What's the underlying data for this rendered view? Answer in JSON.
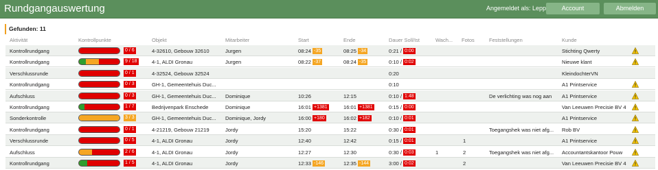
{
  "app": {
    "title": "Rundgangauswertung"
  },
  "header": {
    "logged_in_label": "Angemeldet als: Lepp",
    "account_label": "Account",
    "logout_label": "Abmelden"
  },
  "summary": {
    "found_label": "Gefunden: 11"
  },
  "table": {
    "columns": [
      "Aktivität",
      "Kontrollpunkte",
      "Objekt",
      "Mitarbeiter",
      "Start",
      "Ende",
      "Dauer Soll/Ist",
      "Wach...",
      "Fotos",
      "Feststellungen",
      "Kunde"
    ],
    "rows": [
      {
        "activity": "Kontrollrundgang",
        "progress": "0 / 6",
        "bar": [
          {
            "color": "#e00000",
            "frac": 1
          }
        ],
        "badge_color": "#e00000",
        "object": "4-32610, Gebouw 32610",
        "employee": "Jurgen",
        "start": "08:24",
        "start_badge": "-35",
        "start_badge_color": "#f5a623",
        "end": "08:25",
        "end_badge": "-34",
        "end_badge_color": "#f5a623",
        "duration": "0:21 /",
        "duration_badge": "0:00",
        "duration_badge_color": "#e00000",
        "wach": "",
        "photos": "",
        "findings": "",
        "customer": "Stichting Qwerty",
        "warning": true
      },
      {
        "activity": "Kontrollrundgang",
        "progress": "9 / 18",
        "bar": [
          {
            "color": "#2e9e2e",
            "frac": 0.17
          },
          {
            "color": "#f5a623",
            "frac": 0.33
          },
          {
            "color": "#e00000",
            "frac": 0.5
          }
        ],
        "badge_color": "#e00000",
        "object": "4-1, ALDI Gronau",
        "employee": "Jurgen",
        "start": "08:22",
        "start_badge": "-37",
        "start_badge_color": "#f5a623",
        "end": "08:24",
        "end_badge": "-35",
        "end_badge_color": "#f5a623",
        "duration": "0:10 /",
        "duration_badge": "0:02",
        "duration_badge_color": "#e00000",
        "wach": "",
        "photos": "",
        "findings": "",
        "customer": "Nieuwe klant",
        "warning": true
      },
      {
        "activity": "Verschlussrunde",
        "progress": "0 / 1",
        "bar": [
          {
            "color": "#e00000",
            "frac": 1
          }
        ],
        "badge_color": "#e00000",
        "object": "4-32524, Gebouw 32524",
        "employee": "",
        "start": "",
        "start_badge": "",
        "start_badge_color": "",
        "end": "",
        "end_badge": "",
        "end_badge_color": "",
        "duration": "0:20",
        "duration_badge": "",
        "duration_badge_color": "",
        "wach": "",
        "photos": "",
        "findings": "",
        "customer": "KleindochterVN",
        "warning": false
      },
      {
        "activity": "Kontrollrundgang",
        "progress": "0 / 3",
        "bar": [
          {
            "color": "#e00000",
            "frac": 1
          }
        ],
        "badge_color": "#e00000",
        "object": "GH-1, Gemeentehuis Duc...",
        "employee": "",
        "start": "",
        "start_badge": "",
        "start_badge_color": "",
        "end": "",
        "end_badge": "",
        "end_badge_color": "",
        "duration": "0:10",
        "duration_badge": "",
        "duration_badge_color": "",
        "wach": "",
        "photos": "",
        "findings": "",
        "customer": "A1 Printservice",
        "warning": true
      },
      {
        "activity": "Aufschluss",
        "progress": "0 / 3",
        "bar": [
          {
            "color": "#e00000",
            "frac": 1
          }
        ],
        "badge_color": "#e00000",
        "object": "GH-1, Gemeentehuis Duc...",
        "employee": "Dominique",
        "start": "10:26",
        "start_badge": "",
        "start_badge_color": "",
        "end": "12:15",
        "end_badge": "",
        "end_badge_color": "",
        "duration": "0:10 /",
        "duration_badge": "1:48",
        "duration_badge_color": "#e00000",
        "wach": "",
        "photos": "",
        "findings": "De verlichting was nog aan",
        "customer": "A1 Printservice",
        "warning": true
      },
      {
        "activity": "Kontrollrundgang",
        "progress": "1 / 7",
        "bar": [
          {
            "color": "#2e9e2e",
            "frac": 0.14
          },
          {
            "color": "#e00000",
            "frac": 0.86
          }
        ],
        "badge_color": "#e00000",
        "object": "Bedrijvenpark Enschede",
        "employee": "Dominique",
        "start": "16:01",
        "start_badge": "+1381",
        "start_badge_color": "#e00000",
        "end": "16:01",
        "end_badge": "+1381",
        "end_badge_color": "#e00000",
        "duration": "0:15 /",
        "duration_badge": "0:00",
        "duration_badge_color": "#e00000",
        "wach": "",
        "photos": "",
        "findings": "",
        "customer": "Van Leeuwen Precisie BV 4",
        "warning": true
      },
      {
        "activity": "Sonderkontrolle",
        "progress": "3 / 3",
        "bar": [
          {
            "color": "#f5a623",
            "frac": 1
          }
        ],
        "badge_color": "#f5a623",
        "object": "GH-1, Gemeentehuis Duc...",
        "employee": "Dominique, Jordy",
        "start": "16:00",
        "start_badge": "+180",
        "start_badge_color": "#e00000",
        "end": "16:02",
        "end_badge": "+182",
        "end_badge_color": "#e00000",
        "duration": "0:10 /",
        "duration_badge": "0:01",
        "duration_badge_color": "#e00000",
        "wach": "",
        "photos": "",
        "findings": "",
        "customer": "A1 Printservice",
        "warning": true
      },
      {
        "activity": "Kontrollrundgang",
        "progress": "0 / 1",
        "bar": [
          {
            "color": "#e00000",
            "frac": 1
          }
        ],
        "badge_color": "#e00000",
        "object": "4-21219, Gebouw 21219",
        "employee": "Jordy",
        "start": "15:20",
        "start_badge": "",
        "start_badge_color": "",
        "end": "15:22",
        "end_badge": "",
        "end_badge_color": "",
        "duration": "0:30 /",
        "duration_badge": "0:01",
        "duration_badge_color": "#e00000",
        "wach": "",
        "photos": "",
        "findings": "Toegangshek was niet afg...",
        "customer": "Rob BV",
        "warning": true
      },
      {
        "activity": "Verschlussrunde",
        "progress": "0 / 5",
        "bar": [
          {
            "color": "#e00000",
            "frac": 1
          }
        ],
        "badge_color": "#e00000",
        "object": "4-1, ALDI Gronau",
        "employee": "Jordy",
        "start": "12:40",
        "start_badge": "",
        "start_badge_color": "",
        "end": "12:42",
        "end_badge": "",
        "end_badge_color": "",
        "duration": "0:15 /",
        "duration_badge": "0:01",
        "duration_badge_color": "#e00000",
        "wach": "",
        "photos": "1",
        "findings": "",
        "customer": "A1 Printservice",
        "warning": true
      },
      {
        "activity": "Aufschluss",
        "progress": "2 / 6",
        "bar": [
          {
            "color": "#f5a623",
            "frac": 0.33
          },
          {
            "color": "#e00000",
            "frac": 0.67
          }
        ],
        "badge_color": "#e00000",
        "object": "4-1, ALDI Gronau",
        "employee": "Jordy",
        "start": "12:27",
        "start_badge": "",
        "start_badge_color": "",
        "end": "12:30",
        "end_badge": "",
        "end_badge_color": "",
        "duration": "0:30 /",
        "duration_badge": "0:03",
        "duration_badge_color": "#e00000",
        "wach": "1",
        "photos": "2",
        "findings": "Toegangshek was niet afg...",
        "customer": "Accountantskantoor Pouw",
        "warning": true
      },
      {
        "activity": "Kontrollrundgang",
        "progress": "1 / 5",
        "bar": [
          {
            "color": "#2e9e2e",
            "frac": 0.2
          },
          {
            "color": "#e00000",
            "frac": 0.8
          }
        ],
        "badge_color": "#e00000",
        "object": "4-1, ALDI Gronau",
        "employee": "Jordy",
        "start": "12:33",
        "start_badge": "-146",
        "start_badge_color": "#f5a623",
        "end": "12:35",
        "end_badge": "-144",
        "end_badge_color": "#f5a623",
        "duration": "3:00 /",
        "duration_badge": "0:02",
        "duration_badge_color": "#e00000",
        "wach": "",
        "photos": "2",
        "findings": "",
        "customer": "Van Leeuwen Precisie BV 4",
        "warning": true
      }
    ]
  },
  "icons": {
    "warning": "warning-triangle-icon"
  },
  "colors": {
    "header": "#5b8f5c",
    "button": "#86b587",
    "ok": "#2e9e2e",
    "partial": "#f5a623",
    "missing": "#e00000"
  }
}
